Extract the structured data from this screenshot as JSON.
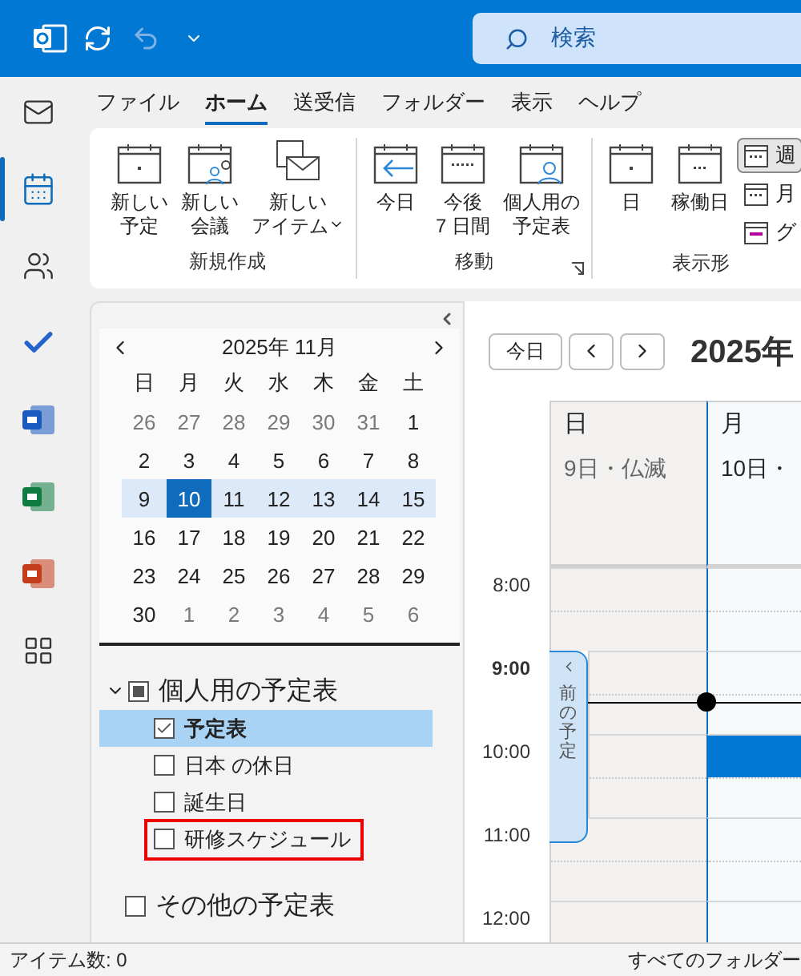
{
  "title_bar": {
    "search": {
      "placeholder": "検索"
    }
  },
  "nav_rail": [
    {
      "selected": false
    },
    {
      "selected": true
    },
    {
      "selected": false
    },
    {
      "selected": false
    },
    {
      "selected": false
    },
    {
      "selected": false
    },
    {
      "selected": false
    },
    {
      "selected": false
    }
  ],
  "menu_tabs": [
    {
      "label": "ファイル",
      "selected": false
    },
    {
      "label": "ホーム",
      "selected": true
    },
    {
      "label": "送受信",
      "selected": false
    },
    {
      "label": "フォルダー",
      "selected": false
    },
    {
      "label": "表示",
      "selected": false
    },
    {
      "label": "ヘルプ",
      "selected": false
    }
  ],
  "ribbon": [
    {
      "label": "新規作成",
      "launcher": false,
      "buttons": [
        {
          "kind": "large",
          "lines": [
            "新しい",
            "予定"
          ],
          "dropdown": false,
          "selected": false
        },
        {
          "kind": "large",
          "lines": [
            "新しい",
            "会議"
          ],
          "dropdown": false,
          "selected": false
        },
        {
          "kind": "large",
          "lines": [
            "新しい",
            "アイテム"
          ],
          "dropdown": true,
          "selected": false
        }
      ]
    },
    {
      "label": "移動",
      "launcher": true,
      "buttons": [
        {
          "kind": "large",
          "lines": [
            "今日"
          ],
          "dropdown": false,
          "selected": false
        },
        {
          "kind": "large",
          "lines": [
            "今後",
            "7 日間"
          ],
          "dropdown": false,
          "selected": false
        },
        {
          "kind": "large",
          "lines": [
            "個人用の",
            "予定表"
          ],
          "dropdown": false,
          "selected": false
        }
      ]
    },
    {
      "label": "表示形",
      "launcher": false,
      "buttons": [
        {
          "kind": "large",
          "lines": [
            "日"
          ],
          "dropdown": false,
          "selected": false
        },
        {
          "kind": "large",
          "lines": [
            "稼働日"
          ],
          "dropdown": false,
          "selected": false
        },
        {
          "kind": "small",
          "lines": [
            "週"
          ],
          "dropdown": false,
          "selected": true
        },
        {
          "kind": "small",
          "lines": [
            "月"
          ],
          "dropdown": false,
          "selected": false
        },
        {
          "kind": "small",
          "lines": [
            "グ"
          ],
          "dropdown": false,
          "selected": false
        }
      ]
    }
  ],
  "mini_calendar": {
    "title": "2025年 11月",
    "weekdays": [
      "日",
      "月",
      "火",
      "水",
      "木",
      "金",
      "土"
    ],
    "weeks": [
      {
        "selected": false,
        "days": [
          {
            "label": "26",
            "muted": true,
            "selected": false
          },
          {
            "label": "27",
            "muted": true,
            "selected": false
          },
          {
            "label": "28",
            "muted": true,
            "selected": false
          },
          {
            "label": "29",
            "muted": true,
            "selected": false
          },
          {
            "label": "30",
            "muted": true,
            "selected": false
          },
          {
            "label": "31",
            "muted": true,
            "selected": false
          },
          {
            "label": "1",
            "muted": false,
            "selected": false
          }
        ]
      },
      {
        "selected": false,
        "days": [
          {
            "label": "2",
            "muted": false,
            "selected": false
          },
          {
            "label": "3",
            "muted": false,
            "selected": false
          },
          {
            "label": "4",
            "muted": false,
            "selected": false
          },
          {
            "label": "5",
            "muted": false,
            "selected": false
          },
          {
            "label": "6",
            "muted": false,
            "selected": false
          },
          {
            "label": "7",
            "muted": false,
            "selected": false
          },
          {
            "label": "8",
            "muted": false,
            "selected": false
          }
        ]
      },
      {
        "selected": true,
        "days": [
          {
            "label": "9",
            "muted": false,
            "selected": false
          },
          {
            "label": "10",
            "muted": false,
            "selected": true
          },
          {
            "label": "11",
            "muted": false,
            "selected": false
          },
          {
            "label": "12",
            "muted": false,
            "selected": false
          },
          {
            "label": "13",
            "muted": false,
            "selected": false
          },
          {
            "label": "14",
            "muted": false,
            "selected": false
          },
          {
            "label": "15",
            "muted": false,
            "selected": false
          }
        ]
      },
      {
        "selected": false,
        "days": [
          {
            "label": "16",
            "muted": false,
            "selected": false
          },
          {
            "label": "17",
            "muted": false,
            "selected": false
          },
          {
            "label": "18",
            "muted": false,
            "selected": false
          },
          {
            "label": "19",
            "muted": false,
            "selected": false
          },
          {
            "label": "20",
            "muted": false,
            "selected": false
          },
          {
            "label": "21",
            "muted": false,
            "selected": false
          },
          {
            "label": "22",
            "muted": false,
            "selected": false
          }
        ]
      },
      {
        "selected": false,
        "days": [
          {
            "label": "23",
            "muted": false,
            "selected": false
          },
          {
            "label": "24",
            "muted": false,
            "selected": false
          },
          {
            "label": "25",
            "muted": false,
            "selected": false
          },
          {
            "label": "26",
            "muted": false,
            "selected": false
          },
          {
            "label": "27",
            "muted": false,
            "selected": false
          },
          {
            "label": "28",
            "muted": false,
            "selected": false
          },
          {
            "label": "29",
            "muted": false,
            "selected": false
          }
        ]
      },
      {
        "selected": false,
        "days": [
          {
            "label": "30",
            "muted": false,
            "selected": false
          },
          {
            "label": "1",
            "muted": true,
            "selected": false
          },
          {
            "label": "2",
            "muted": true,
            "selected": false
          },
          {
            "label": "3",
            "muted": true,
            "selected": false
          },
          {
            "label": "4",
            "muted": true,
            "selected": false
          },
          {
            "label": "5",
            "muted": true,
            "selected": false
          },
          {
            "label": "6",
            "muted": true,
            "selected": false
          }
        ]
      }
    ]
  },
  "calendar_groups": [
    {
      "label": "個人用の予定表",
      "expanded": true,
      "checked": false,
      "mixed": true,
      "items": [
        {
          "label": "予定表",
          "checked": true,
          "selected": true,
          "outlined": false
        },
        {
          "label": "日本 の休日",
          "checked": false,
          "selected": false,
          "outlined": false
        },
        {
          "label": "誕生日",
          "checked": false,
          "selected": false,
          "outlined": false
        },
        {
          "label": "研修スケジュール",
          "checked": false,
          "selected": false,
          "outlined": true
        }
      ]
    },
    {
      "label": "その他の予定表",
      "expanded": false,
      "checked": false,
      "mixed": false
    }
  ],
  "day_view": {
    "today_button": "今日",
    "title": "2025年",
    "columns": [
      {
        "weekday": "日",
        "date": "9日・仏滅",
        "weekend": true,
        "selected": false,
        "has_event": false
      },
      {
        "weekday": "月",
        "date": "10日・",
        "weekend": false,
        "selected": true,
        "has_event": true
      }
    ],
    "hours": [
      {
        "label": "8:00",
        "now": false
      },
      {
        "label": "9:00",
        "now": true
      },
      {
        "label": "10:00",
        "now": false
      },
      {
        "label": "11:00",
        "now": false
      },
      {
        "label": "12:00",
        "now": false
      }
    ],
    "previous_tab": "前の予定"
  },
  "status_bar": {
    "left": "アイテム数: 0",
    "right": "すべてのフォルダー"
  }
}
